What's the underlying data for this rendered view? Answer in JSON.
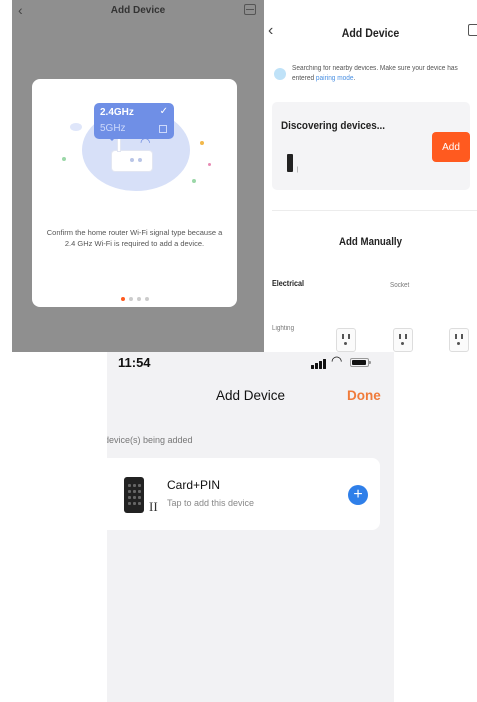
{
  "panel_a": {
    "title": "Add Device",
    "popup": {
      "band1": "2.4GHz",
      "band2": "5GHz"
    },
    "message": "Confirm the home router Wi-Fi signal type because a 2.4 GHz Wi-Fi is required to add a device.",
    "dots": {
      "count": 4,
      "active": 1
    }
  },
  "panel_b": {
    "title": "Add Device",
    "note_text": "Searching for nearby devices. Make sure your device has entered ",
    "note_link": "pairing mode",
    "note_end": ".",
    "discovering_label": "Discovering devices...",
    "add_label": "Add",
    "manual_title": "Add Manually",
    "categories": [
      "Electrical",
      "Socket",
      "Lighting"
    ]
  },
  "panel_c": {
    "time": "11:54",
    "title": "Add Device",
    "done_label": "Done",
    "section_label": "device(s) being added",
    "device": {
      "name": "Card+PIN",
      "subtitle": "Tap to add this device",
      "badge": "II"
    }
  },
  "colors": {
    "accent_orange": "#ff5a1f",
    "done_orange": "#f07b3a",
    "link_blue": "#4a90e2",
    "add_blue": "#2f7fe9"
  },
  "icons": [
    "back-chevron-icon",
    "scan-icon",
    "router-icon",
    "wifi-icon",
    "radar-icon",
    "socket-icon",
    "signal-icon",
    "battery-icon",
    "keypad-icon",
    "plus-icon"
  ]
}
